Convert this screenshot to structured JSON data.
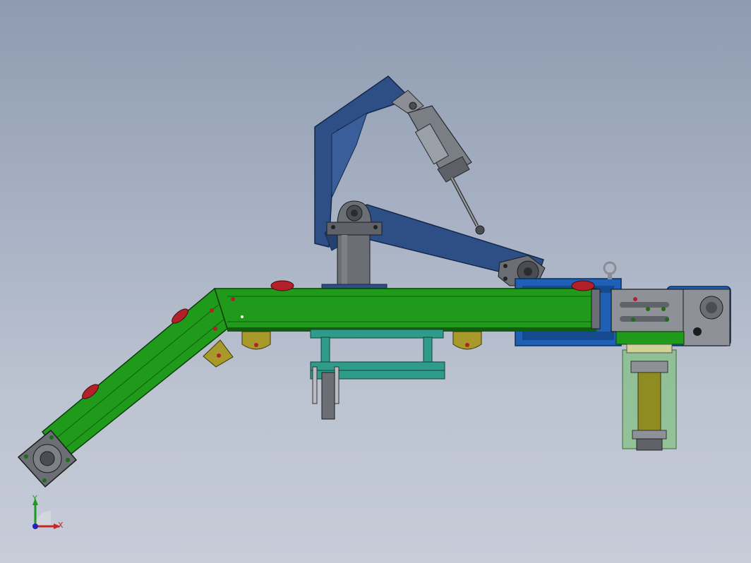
{
  "viewport": {
    "background_top": "#8e9bb0",
    "background_bottom": "#c6ccd8"
  },
  "colors": {
    "frame_green": "#1f9a1a",
    "frame_green_dark": "#0f5f0c",
    "arm_blue": "#2d4f86",
    "arm_blue_dark": "#1b355f",
    "teal_bracket": "#2f9b8a",
    "steel_grey": "#6e7178",
    "wheel_olive": "#a89a2a",
    "motor_blue": "#1f5fb5",
    "roller_red": "#b3202a"
  },
  "triad": {
    "x_label": "X",
    "y_label": "Y",
    "z_label": "Z"
  }
}
